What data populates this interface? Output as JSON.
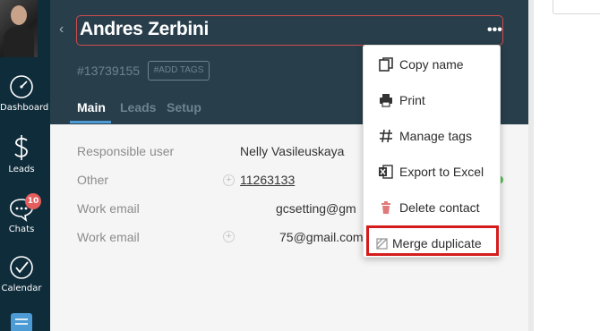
{
  "nav": {
    "items": [
      {
        "label": "Dashboard"
      },
      {
        "label": "Leads"
      },
      {
        "label": "Chats",
        "badge": "10"
      },
      {
        "label": "Calendar"
      }
    ]
  },
  "contact": {
    "name": "Andres Zerbini",
    "id": "#13739155",
    "add_tags": "#ADD TAGS"
  },
  "tabs": [
    {
      "label": "Main",
      "active": true
    },
    {
      "label": "Leads",
      "active": false
    },
    {
      "label": "Setup",
      "active": false
    }
  ],
  "fields": [
    {
      "label": "Responsible user",
      "value": "Nelly Vasileuskaya"
    },
    {
      "label": "Other",
      "value": "11263133"
    },
    {
      "label": "Work email",
      "value": "gcsetting@gm"
    },
    {
      "label": "Work email",
      "value": "75@gmail.com"
    }
  ],
  "menu": {
    "items": [
      {
        "label": "Copy name",
        "icon": "copy-icon"
      },
      {
        "label": "Print",
        "icon": "printer-icon"
      },
      {
        "label": "Manage tags",
        "icon": "hash-icon"
      },
      {
        "label": "Export to Excel",
        "icon": "excel-icon"
      },
      {
        "label": "Delete contact",
        "icon": "trash-icon"
      },
      {
        "label": "Merge duplicate",
        "icon": "merge-icon"
      }
    ],
    "highlighted": "Merge duplicate"
  },
  "colors": {
    "nav_bg": "#0f2c3b",
    "header_bg": "#283e4b",
    "accent": "#4d9bd4",
    "highlight": "#d41c1c",
    "badge": "#e65d5d"
  }
}
